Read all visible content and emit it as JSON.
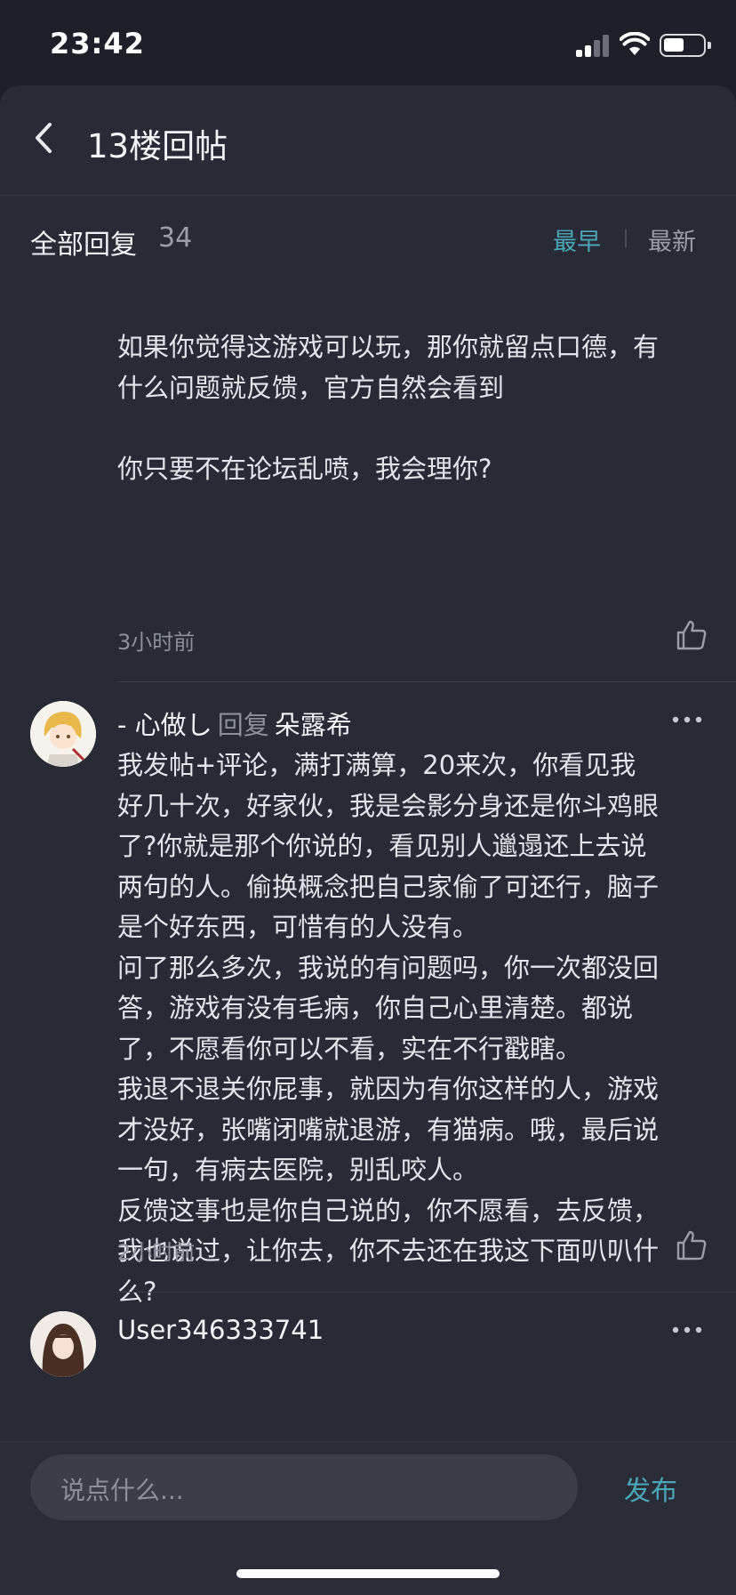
{
  "status": {
    "time": "23:42"
  },
  "nav": {
    "title": "13楼回帖"
  },
  "header": {
    "all_label": "全部回复",
    "count": "34",
    "sort_earliest": "最早",
    "sort_latest": "最新"
  },
  "comments": [
    {
      "body": "如果你觉得这游戏可以玩，那你就留点口德，有\n什么问题就反馈，官方自然会看到\n\n你只要不在论坛乱喷，我会理你?",
      "time": "3小时前"
    },
    {
      "author": "-   心做し",
      "reply_word": "回复",
      "reply_to": "朵露希",
      "body": "我发帖+评论，满打满算，20来次，你看见我\n好几十次，好家伙，我是会影分身还是你斗鸡眼\n了?你就是那个你说的，看见别人邋遢还上去说\n两句的人。偷换概念把自己家偷了可还行，脑子\n是个好东西，可惜有的人没有。\n问了那么多次，我说的有问题吗，你一次都没回\n答，游戏有没有毛病，你自己心里清楚。都说\n了，不愿看你可以不看，实在不行戳瞎。\n我退不退关你屁事，就因为有你这样的人，游戏\n才没好，张嘴闭嘴就退游，有猫病。哦，最后说\n一句，有病去医院，别乱咬人。\n反馈这事也是你自己说的，你不愿看，去反馈，\n我也说过，让你去，你不去还在我这下面叭叭什\n么?",
      "time": "2小时前"
    },
    {
      "author": "User346333741"
    }
  ],
  "input": {
    "placeholder": "说点什么...",
    "publish_label": "发布"
  },
  "colors": {
    "accent": "#4ba6b8",
    "sheet_bg": "#282b36",
    "page_bg": "#1d2029"
  }
}
